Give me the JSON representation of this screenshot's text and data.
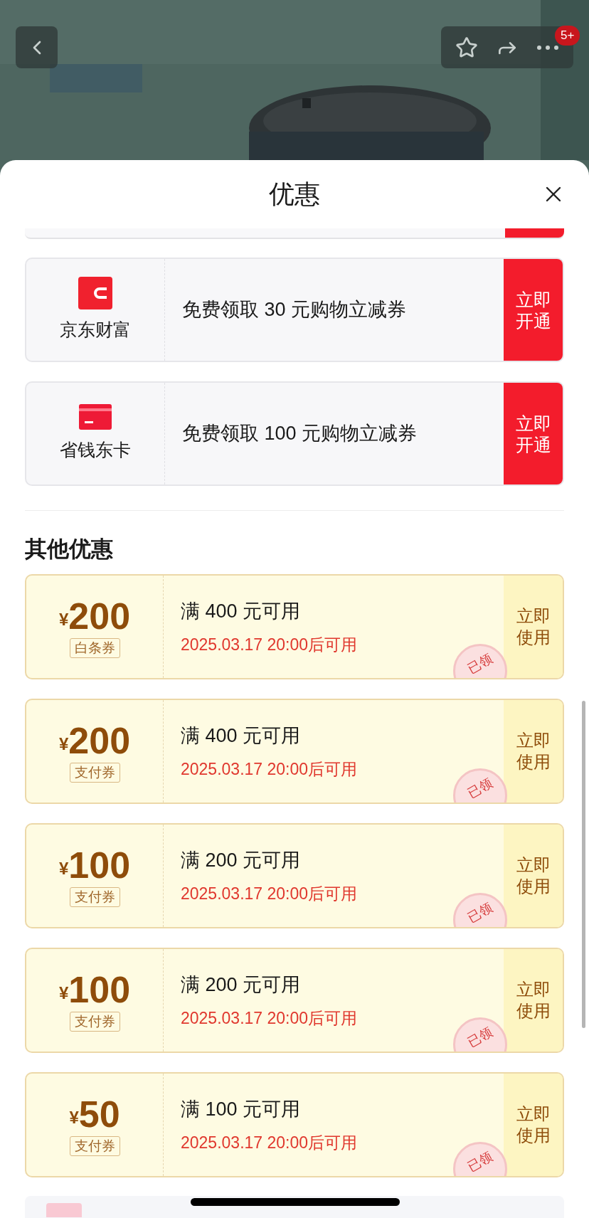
{
  "header": {
    "badge": "5+"
  },
  "sheet": {
    "title": "优惠"
  },
  "top_offers": [
    {
      "kind": "wallet",
      "brand": "京东财富",
      "text": "免费领取 30 元购物立减券",
      "button": "立即开通"
    },
    {
      "kind": "card",
      "brand": "省钱东卡",
      "text": "免费领取 100 元购物立减券",
      "button": "立即开通"
    }
  ],
  "section_title": "其他优惠",
  "coupons": [
    {
      "currency": "¥",
      "amount": "200",
      "type": "白条券",
      "condition": "满 400 元可用",
      "valid_from": "2025.03.17 20:00后可用",
      "button": "立即使用",
      "claimed": true,
      "stamp": "已领"
    },
    {
      "currency": "¥",
      "amount": "200",
      "type": "支付券",
      "condition": "满 400 元可用",
      "valid_from": "2025.03.17 20:00后可用",
      "button": "立即使用",
      "claimed": true,
      "stamp": "已领"
    },
    {
      "currency": "¥",
      "amount": "100",
      "type": "支付券",
      "condition": "满 200 元可用",
      "valid_from": "2025.03.17 20:00后可用",
      "button": "立即使用",
      "claimed": true,
      "stamp": "已领"
    },
    {
      "currency": "¥",
      "amount": "100",
      "type": "支付券",
      "condition": "满 200 元可用",
      "valid_from": "2025.03.17 20:00后可用",
      "button": "立即使用",
      "claimed": true,
      "stamp": "已领"
    },
    {
      "currency": "¥",
      "amount": "50",
      "type": "支付券",
      "condition": "满 100 元可用",
      "valid_from": "2025.03.17 20:00后可用",
      "button": "立即使用",
      "claimed": true,
      "stamp": "已领"
    }
  ]
}
